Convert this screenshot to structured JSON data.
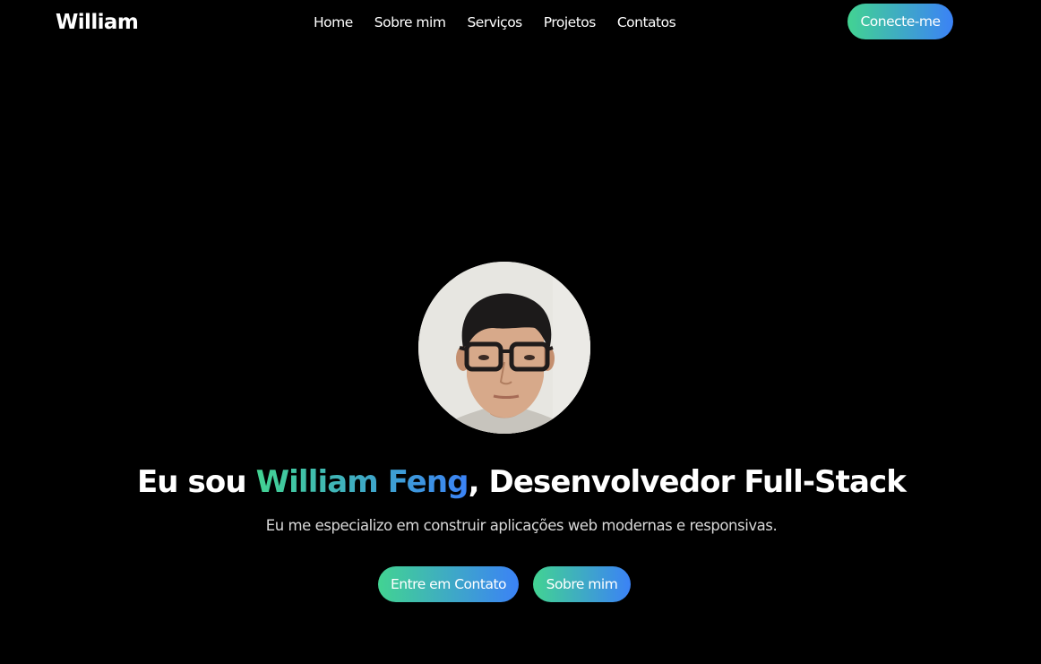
{
  "nav": {
    "logo": "William",
    "links": [
      "Home",
      "Sobre mim",
      "Serviços",
      "Projetos",
      "Contatos"
    ],
    "cta_label": "Conecte-me"
  },
  "hero": {
    "avatar_alt": "William Feng",
    "title_prefix": "Eu sou ",
    "title_name": "William Feng",
    "title_suffix": ", Desenvolvedor Full-Stack",
    "subtitle": "Eu me especializo em construir aplicações web modernas e responsivas.",
    "buttons": {
      "contact_label": "Entre em Contato",
      "about_label": "Sobre mim"
    }
  },
  "colors": {
    "background": "#000000",
    "text": "#ffffff",
    "subtitle_text": "#d9d9d9",
    "gradient_start": "#42d392",
    "gradient_end": "#3b82f6"
  },
  "icons": {
    "avatar": "profile-photo"
  }
}
